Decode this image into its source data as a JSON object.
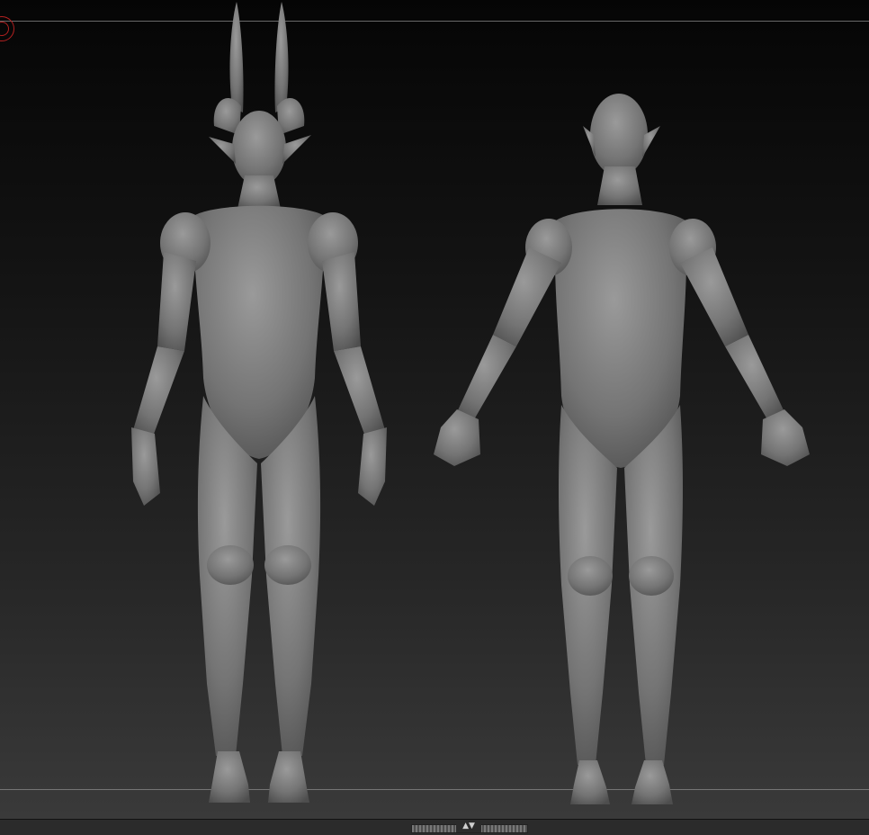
{
  "viewport": {
    "background_top": "#050505",
    "background_bottom": "#3a3a3a",
    "model_color": "#7a7a7a",
    "pivot_color": "#b32020"
  },
  "models": [
    {
      "name": "horned-elf-figure",
      "pose": "a-pose",
      "has_horns": true
    },
    {
      "name": "elf-figure",
      "pose": "arms-out",
      "has_horns": false
    }
  ],
  "icons": {
    "pivot": "transpose-pivot-icon",
    "collapse": "collapse-arrows-icon"
  },
  "bottom_bar": {
    "toggle_symbol": "▲▼"
  }
}
